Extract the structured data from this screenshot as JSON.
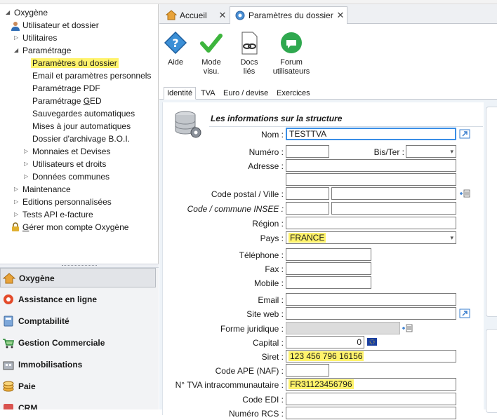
{
  "tree": {
    "root": "Oxygène",
    "items": [
      {
        "label": "Utilisateur et dossier",
        "icon": "user-icon"
      },
      {
        "label": "Utilitaires"
      },
      {
        "label": "Paramétrage"
      },
      {
        "label": "Paramètres du dossier",
        "selected": true
      },
      {
        "label": "Email et paramètres personnels"
      },
      {
        "label": "Paramétrage PDF"
      },
      {
        "label_pre": "Paramétrage ",
        "label_ul": "G",
        "label_post": "ED"
      },
      {
        "label": "Sauvegardes automatiques"
      },
      {
        "label": "Mises à jour automatiques"
      },
      {
        "label": "Dossier d'archivage B.O.I."
      },
      {
        "label": "Monnaies et Devises"
      },
      {
        "label": "Utilisateurs et droits"
      },
      {
        "label": "Données communes"
      },
      {
        "label": "Maintenance"
      },
      {
        "label": "Editions personnalisées"
      },
      {
        "label": "Tests API e-facture"
      },
      {
        "label_ul": "G",
        "label_post": "érer mon compte Oxygène",
        "icon": "lock-icon"
      }
    ]
  },
  "modules": [
    {
      "label": "Oxygène",
      "icon": "home-icon",
      "active": true
    },
    {
      "label": "Assistance en ligne",
      "icon": "lifebuoy-icon"
    },
    {
      "label": "Comptabilité",
      "icon": "calculator-icon"
    },
    {
      "label": "Gestion Commerciale",
      "icon": "cart-icon"
    },
    {
      "label": "Immobilisations",
      "icon": "building-icon"
    },
    {
      "label": "Paie",
      "icon": "coins-icon"
    },
    {
      "label": "CRM",
      "icon": "contacts-icon"
    }
  ],
  "doc_tabs": [
    {
      "label": "Accueil",
      "icon": "home-icon"
    },
    {
      "label": "Paramètres du dossier",
      "icon": "gear-icon",
      "active": true
    }
  ],
  "toolbar": {
    "aide": "Aide",
    "mode_1": "Mode",
    "mode_2": "visu.",
    "docs_1": "Docs",
    "docs_2": "liés",
    "forum_1": "Forum",
    "forum_2": "utilisateurs"
  },
  "form_tabs": [
    "Identité",
    "TVA",
    "Euro / devise",
    "Exercices"
  ],
  "section_title": "Les informations sur la structure",
  "fields": {
    "nom_label": "Nom :",
    "nom_value": "TESTTVA",
    "numero_label": "Numéro :",
    "bister_label": "Bis/Ter :",
    "adresse_label": "Adresse :",
    "cp_label": "Code postal / Ville :",
    "insee_label": "Code / commune INSEE :",
    "region_label": "Région :",
    "pays_label": "Pays :",
    "pays_value": "FRANCE",
    "tel_label": "Téléphone :",
    "fax_label": "Fax :",
    "mobile_label": "Mobile :",
    "email_label": "Email :",
    "siteweb_label": "Site web :",
    "forme_label": "Forme juridique :",
    "capital_label": "Capital :",
    "capital_value": "0",
    "siret_label": "Siret :",
    "siret_value": "123 456 796 16156",
    "ape_label": "Code APE (NAF) :",
    "tva_label": "N° TVA intracommunautaire :",
    "tva_value": "FR31123456796",
    "edi_label": "Code EDI :",
    "rcs_label": "Numéro RCS :"
  },
  "colors": {
    "highlight": "#fff36b",
    "accent": "#3a8ee6",
    "check_green": "#3db53d"
  }
}
